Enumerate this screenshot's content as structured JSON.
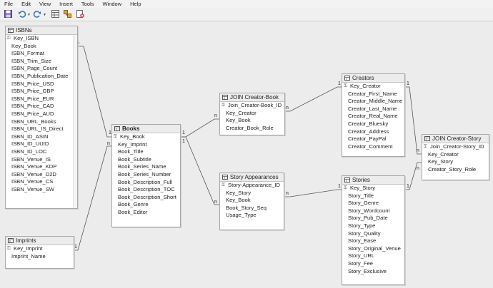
{
  "menu": [
    "File",
    "Edit",
    "View",
    "Insert",
    "Tools",
    "Window",
    "Help"
  ],
  "toolbar": [
    {
      "name": "save-icon"
    },
    {
      "name": "undo-icon"
    },
    {
      "name": "redo-icon"
    },
    {
      "name": "add-tables-icon"
    },
    {
      "name": "new-relation-icon"
    },
    {
      "name": "delete-icon"
    }
  ],
  "tables": {
    "isbns": {
      "title": "ISBNs",
      "fields": [
        "Key_ISBN",
        "Key_Book",
        "ISBN_Format",
        "ISBN_Trim_Size",
        "ISBN_Page_Count",
        "ISBN_Publication_Date",
        "ISBN_Price_USD",
        "ISBN_Price_GBP",
        "ISBN_Price_EUR",
        "ISBN_Price_CAD",
        "ISBN_Price_AUD",
        "ISBN_URL_Books",
        "ISBN_URL_IS_Direct",
        "ISBN_ID_ASIN",
        "ISBN_ID_UUID",
        "ISBN_ID_LOC",
        "ISBN_Venue_IS",
        "ISBN_Venue_KDP",
        "ISBN_Venue_D2D",
        "ISBN_Venue_CS",
        "ISBN_Venue_SW"
      ]
    },
    "imprints": {
      "title": "Imprints",
      "fields": [
        "Key_Imprint",
        "Imprint_Name"
      ]
    },
    "books": {
      "title": "Books",
      "fields": [
        "Key_Book",
        "Key_Imprint",
        "Book_Title",
        "Book_Subtitle",
        "Book_Series_Name",
        "Book_Series_Number",
        "Book_Description_Full",
        "Book_Description_TOC",
        "Book_Description_Short",
        "Book_Genre",
        "Book_Editor"
      ]
    },
    "join_creator_book": {
      "title": "JOIN Creator-Book",
      "fields": [
        "Join_Creator-Book_ID",
        "Key_Creator",
        "Key_Book",
        "Creator_Book_Role"
      ]
    },
    "story_appearances": {
      "title": "Story Appearances",
      "fields": [
        "Story-Appearance_ID",
        "Key_Story",
        "Key_Book",
        "Book_Story_Seq",
        "Usage_Type"
      ]
    },
    "creators": {
      "title": "Creators",
      "fields": [
        "Key_Creator",
        "Creator_First_Name",
        "Creator_Middle_Name",
        "Creator_Last_Name",
        "Creator_Real_Name",
        "Creator_Bluesky",
        "Creator_Address",
        "Creator_PayPal",
        "Creator_Comment"
      ]
    },
    "stories": {
      "title": "Stories",
      "fields": [
        "Key_Story",
        "Story_Title",
        "Story_Genre",
        "Story_Wordcount",
        "Story_Pub_Date",
        "Story_Type",
        "Story_Quality",
        "Story_Ease",
        "Story_Original_Venue",
        "Story_URL",
        "Story_Fee",
        "Story_Exclusive"
      ]
    },
    "join_creator_story": {
      "title": "JOIN Creator-Story",
      "fields": [
        "Join_Creator-Story_ID",
        "Key_Creator",
        "Key_Story",
        "Creator_Story_Role"
      ]
    }
  },
  "cardinality": {
    "one": "1",
    "many": "n"
  }
}
